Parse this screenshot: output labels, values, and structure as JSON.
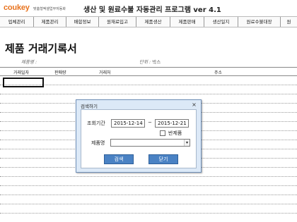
{
  "header": {
    "logo_text": "coukey",
    "logo_sub": "맞춤형엑셀업무자동화",
    "title": "생산 및 원료수불 자동관리 프로그램 ver 4.1"
  },
  "nav": {
    "items": [
      {
        "label": "업체관리"
      },
      {
        "label": "제품관리"
      },
      {
        "label": "배합정보"
      },
      {
        "label": "원재료입고"
      },
      {
        "label": "제품생산"
      },
      {
        "label": "제품판매"
      },
      {
        "label": "생산일지"
      },
      {
        "label": "원료수불대장"
      },
      {
        "label": "원"
      }
    ]
  },
  "page": {
    "title": "제품 거래기록서",
    "product_label": "제품명 :",
    "unit_label": "단위 :",
    "unit_value": "박스"
  },
  "table": {
    "headers": [
      "거래일자",
      "판매량",
      "거래처",
      "주소"
    ],
    "row_count": 16
  },
  "dialog": {
    "title": "검색하기",
    "close_glyph": "×",
    "period_label": "조회기간",
    "start_date": "2015-12-14",
    "tilde": "~",
    "end_date": "2015-12-21",
    "return_label": "반제품",
    "return_checked": false,
    "product_label": "제품명",
    "product_value": "",
    "search_button": "검색",
    "close_button": "닫기"
  }
}
